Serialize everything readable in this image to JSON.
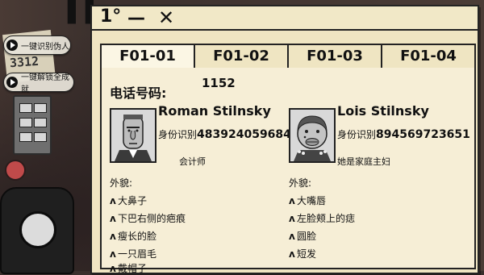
{
  "scene": {
    "paper_note_number": "3312"
  },
  "side_buttons": [
    {
      "label": "一键识别伪人"
    },
    {
      "label": "一键解锁全成就"
    }
  ],
  "window": {
    "title": "1°",
    "min_glyph": "—",
    "close_glyph": "✕",
    "tabs": [
      {
        "label": "F01-01",
        "active": true
      },
      {
        "label": "F01-02",
        "active": false
      },
      {
        "label": "F01-03",
        "active": false
      },
      {
        "label": "F01-04",
        "active": false
      }
    ],
    "phone_label": "电话号码:",
    "phone_value": "1152"
  },
  "persons": [
    {
      "name": "Roman Stilnsky",
      "id_label": "身份识别",
      "id_number": "483924059684",
      "job": "会计师",
      "looks_label": "外貌:",
      "features": [
        "大鼻子",
        "下巴右侧的疤痕",
        "瘦长的脸",
        "一只眉毛",
        "戴帽子"
      ]
    },
    {
      "name": "Lois Stilnsky",
      "id_label": "身份识别",
      "id_number": "894569723651",
      "job": "她是家庭主妇",
      "looks_label": "外貌:",
      "features": [
        "大嘴唇",
        "左脸颊上的痣",
        "圆脸",
        "短发"
      ]
    }
  ],
  "colors": {
    "paper": "#efe5c2",
    "ink": "#111111",
    "background": "#3a2f2c"
  }
}
